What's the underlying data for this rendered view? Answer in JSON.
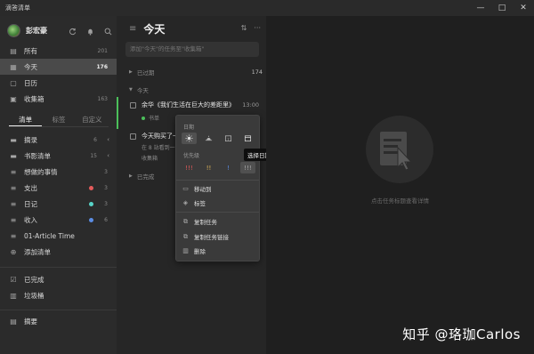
{
  "app": {
    "title": "滴答清单"
  },
  "window_controls": [
    "—",
    "□",
    "✕"
  ],
  "user": {
    "name": "彭宏豪"
  },
  "smart_lists": [
    {
      "label": "所有",
      "count": "201",
      "icon": "inbox-stack-icon"
    },
    {
      "label": "今天",
      "count": "176",
      "icon": "calendar-today-icon",
      "active": true
    },
    {
      "label": "日历",
      "count": "",
      "icon": "calendar-icon"
    },
    {
      "label": "收集箱",
      "count": "163",
      "icon": "inbox-icon"
    }
  ],
  "sidebar_tabs": [
    "清单",
    "标签",
    "自定义"
  ],
  "lists": [
    {
      "label": "摘录",
      "count": "6",
      "icon": "folder-icon",
      "chevron": true
    },
    {
      "label": "书影清单",
      "count": "15",
      "icon": "folder-icon",
      "chevron": true
    },
    {
      "label": "想做的事情",
      "count": "3",
      "icon": "list-icon"
    },
    {
      "label": "支出",
      "count": "3",
      "icon": "list-icon",
      "dot": "#e45b5b"
    },
    {
      "label": "日记",
      "count": "3",
      "icon": "list-icon",
      "dot": "#57d4c8"
    },
    {
      "label": "收入",
      "count": "6",
      "icon": "list-icon",
      "dot": "#5b8de4"
    },
    {
      "label": "01-Article Time",
      "count": "",
      "icon": "list-icon"
    },
    {
      "label": "添加清单",
      "count": "",
      "icon": "add-circle-icon"
    }
  ],
  "bottom_items": [
    {
      "label": "已完成",
      "icon": "check-box-icon"
    },
    {
      "label": "垃圾桶",
      "icon": "trash-icon"
    },
    {
      "label": "摘要",
      "icon": "summary-icon"
    }
  ],
  "main": {
    "title": "今天",
    "add_placeholder": "添加\"今天\"的任务至\"收集箱\"",
    "sections": {
      "overdue": {
        "label": "已过期",
        "count": "174"
      },
      "today": {
        "label": "今天"
      },
      "done": {
        "label": "已完成"
      }
    },
    "tasks": [
      {
        "title": "余华《我们生活在巨大的差距里》",
        "time": "13:00",
        "tag": "书单"
      },
      {
        "title": "今天购买了一",
        "time": "",
        "subline": "在 8 站看到一",
        "tag": "收集箱"
      }
    ]
  },
  "context_menu": {
    "date_label": "日期",
    "priority_label": "优先级",
    "items": [
      "移动到",
      "标签",
      "复制任务",
      "复制任务链接",
      "删除"
    ],
    "priority_marks": [
      "!!!",
      "!!",
      "!",
      "!!!"
    ],
    "priority_colors": [
      "#e45b5b",
      "#e4b85b",
      "#5b8de4",
      "#aaaaaa"
    ]
  },
  "tooltip": "选择日期",
  "detail": {
    "hint": "点击任务标题查看详情"
  },
  "watermark": "知乎 @珞珈Carlos"
}
